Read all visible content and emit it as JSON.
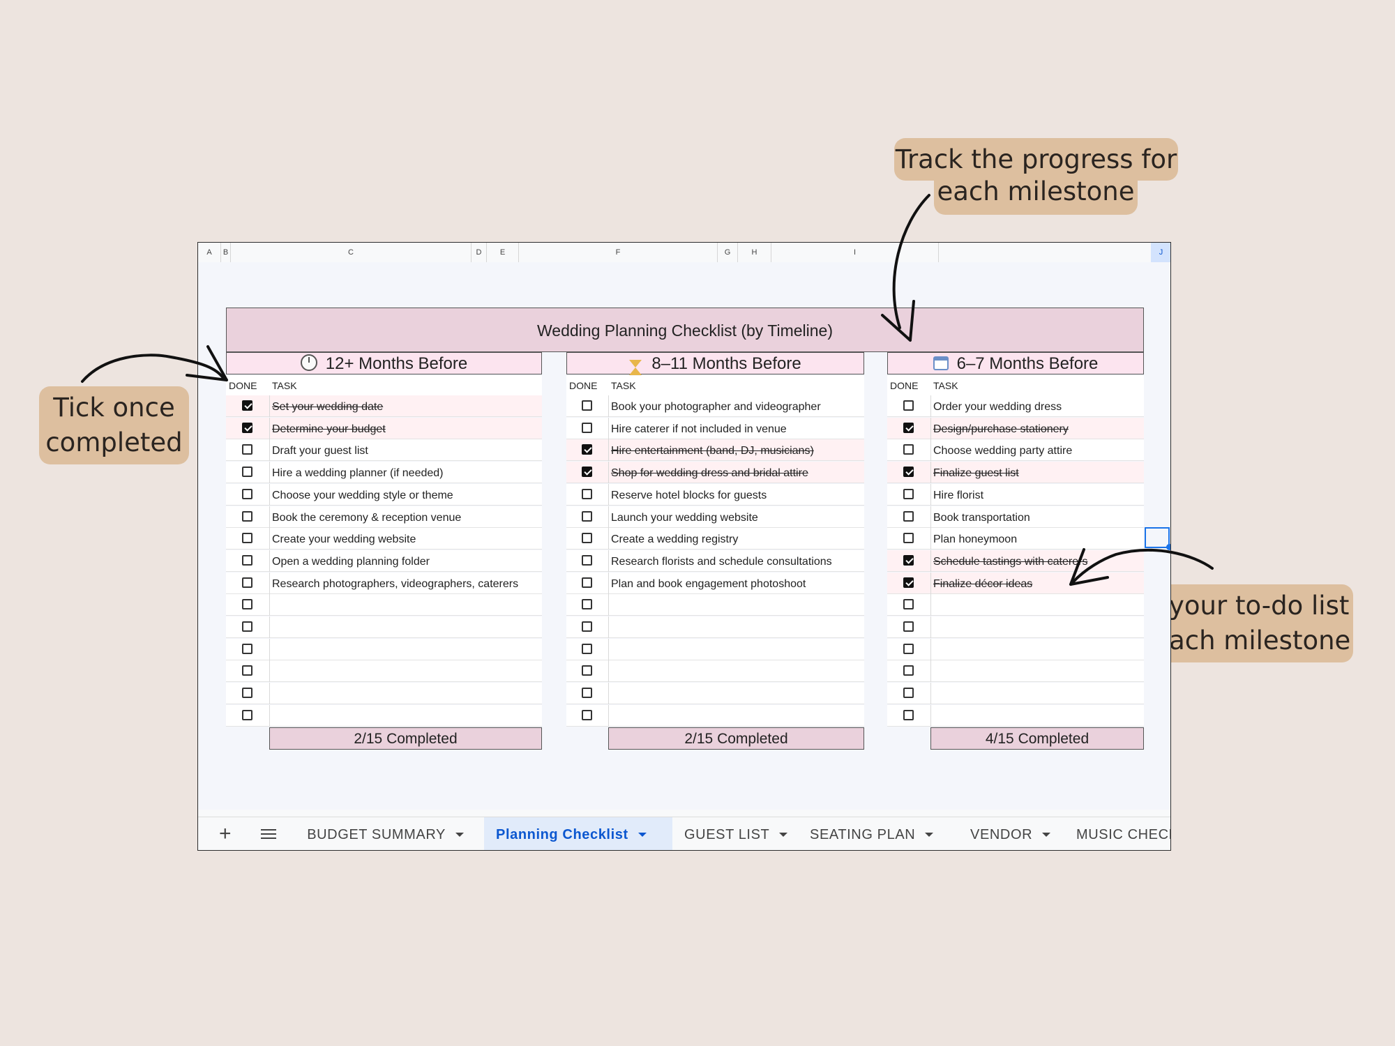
{
  "callouts": {
    "track_line1": "Track the progress for",
    "track_line2": "each milestone",
    "tick_line1": "Tick once",
    "tick_line2": "completed",
    "add_line1": "Add your to-do list",
    "add_line2": "for each milestone"
  },
  "columns": [
    "A",
    "B",
    "C",
    "D",
    "E",
    "F",
    "G",
    "H",
    "I",
    "J"
  ],
  "selected_column": "J",
  "sheet": {
    "title": "Wedding Planning Checklist (by Timeline)",
    "done_header": "DONE",
    "task_header": "TASK",
    "sections": [
      {
        "icon": "clock-icon",
        "heading": "12+ Months Before",
        "completed_label": "2/15 Completed",
        "tasks": [
          {
            "text": "Set your wedding date",
            "done": true
          },
          {
            "text": "Determine your budget",
            "done": true
          },
          {
            "text": "Draft your guest list",
            "done": false
          },
          {
            "text": "Hire a wedding planner (if needed)",
            "done": false
          },
          {
            "text": "Choose your wedding style or theme",
            "done": false
          },
          {
            "text": "Book the ceremony & reception venue",
            "done": false
          },
          {
            "text": "Create your wedding website",
            "done": false
          },
          {
            "text": "Open a wedding planning folder",
            "done": false
          },
          {
            "text": "Research photographers, videographers, caterers",
            "done": false
          },
          {
            "text": "",
            "done": false
          },
          {
            "text": "",
            "done": false
          },
          {
            "text": "",
            "done": false
          },
          {
            "text": "",
            "done": false
          },
          {
            "text": "",
            "done": false
          },
          {
            "text": "",
            "done": false
          }
        ]
      },
      {
        "icon": "hourglass-icon",
        "heading": "8–11 Months Before",
        "completed_label": "2/15 Completed",
        "tasks": [
          {
            "text": "Book your photographer and videographer",
            "done": false
          },
          {
            "text": "Hire caterer if not included in venue",
            "done": false
          },
          {
            "text": "Hire entertainment (band, DJ, musicians)",
            "done": true
          },
          {
            "text": "Shop for wedding dress and bridal attire",
            "done": true
          },
          {
            "text": "Reserve hotel blocks for guests",
            "done": false
          },
          {
            "text": "Launch your wedding website",
            "done": false
          },
          {
            "text": "Create a wedding registry",
            "done": false
          },
          {
            "text": "Research florists and schedule consultations",
            "done": false
          },
          {
            "text": "Plan and book engagement photoshoot",
            "done": false
          },
          {
            "text": "",
            "done": false
          },
          {
            "text": "",
            "done": false
          },
          {
            "text": "",
            "done": false
          },
          {
            "text": "",
            "done": false
          },
          {
            "text": "",
            "done": false
          },
          {
            "text": "",
            "done": false
          }
        ]
      },
      {
        "icon": "calendar-icon",
        "heading": "6–7 Months Before",
        "completed_label": "4/15 Completed",
        "tasks": [
          {
            "text": "Order your wedding dress",
            "done": false
          },
          {
            "text": "Design/purchase stationery",
            "done": true
          },
          {
            "text": "Choose wedding party attire",
            "done": false
          },
          {
            "text": "Finalize guest list",
            "done": true
          },
          {
            "text": "Hire florist",
            "done": false
          },
          {
            "text": "Book transportation",
            "done": false
          },
          {
            "text": "Plan honeymoon",
            "done": false
          },
          {
            "text": "Schedule tastings with caterers",
            "done": true
          },
          {
            "text": "Finalize décor ideas",
            "done": true
          },
          {
            "text": "",
            "done": false
          },
          {
            "text": "",
            "done": false
          },
          {
            "text": "",
            "done": false
          },
          {
            "text": "",
            "done": false
          },
          {
            "text": "",
            "done": false
          },
          {
            "text": "",
            "done": false
          }
        ]
      }
    ]
  },
  "tabs": [
    {
      "label": "BUDGET SUMMARY",
      "active": false
    },
    {
      "label": "Planning Checklist",
      "active": true
    },
    {
      "label": "GUEST LIST",
      "active": false
    },
    {
      "label": "SEATING PLAN",
      "active": false
    },
    {
      "label": "VENDOR",
      "active": false
    },
    {
      "label": "MUSIC CHECKLI",
      "active": false
    }
  ],
  "tab_icons": {
    "add": "+",
    "all_sheets": "menu-icon"
  },
  "colors": {
    "background": "#ede4df",
    "callout": "#ddbf9f",
    "title_fill": "#ead1dc",
    "section_fill": "#fce4ef",
    "active_tab": "#0b57d0"
  }
}
